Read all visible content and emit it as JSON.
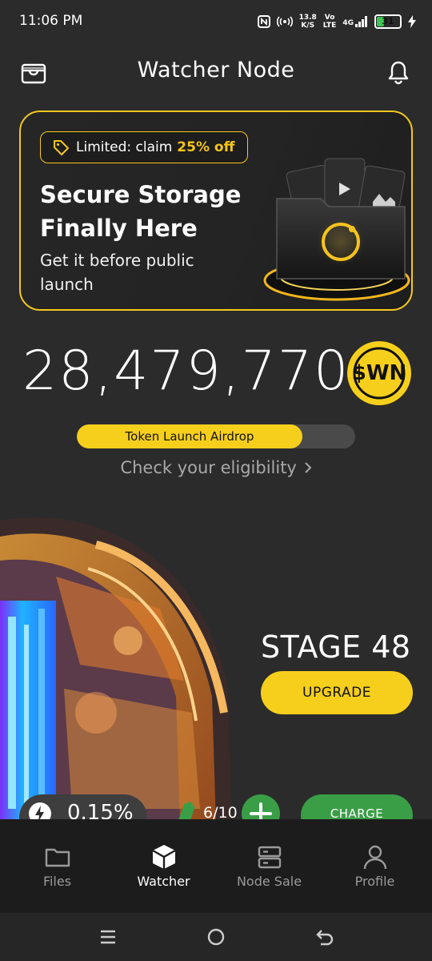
{
  "status_bar": {
    "time": "11:06 PM",
    "net_speed_top": "13.8",
    "net_speed_bottom": "K/S",
    "volte_top": "Vo",
    "volte_bottom": "LTE",
    "signal_label": "4G",
    "battery": "31"
  },
  "header": {
    "title": "Watcher Node"
  },
  "promo": {
    "tag_prefix": "Limited: claim",
    "tag_highlight": "25% off",
    "headline": "Secure Storage Finally Here",
    "subtext": "Get it before public launch"
  },
  "token": {
    "amount": "28,479,770",
    "symbol": "$WN"
  },
  "airdrop": {
    "label": "Token Launch Airdrop",
    "progress_fraction": 0.81,
    "eligibility_link": "Check your eligibility"
  },
  "stage": {
    "label": "STAGE 48",
    "upgrade_button": "UPGRADE"
  },
  "power": {
    "rate": "0.15%",
    "charges": "6/10",
    "charge_button": "CHARGE"
  },
  "nav": {
    "items": [
      {
        "label": "Files",
        "icon": "folder-icon"
      },
      {
        "label": "Watcher",
        "icon": "cube-icon"
      },
      {
        "label": "Node Sale",
        "icon": "server-icon"
      },
      {
        "label": "Profile",
        "icon": "user-icon"
      }
    ],
    "active_index": 1
  },
  "colors": {
    "accent_yellow": "#f6cf1c",
    "accent_green": "#3a9e46",
    "background": "#2b2b2b"
  }
}
